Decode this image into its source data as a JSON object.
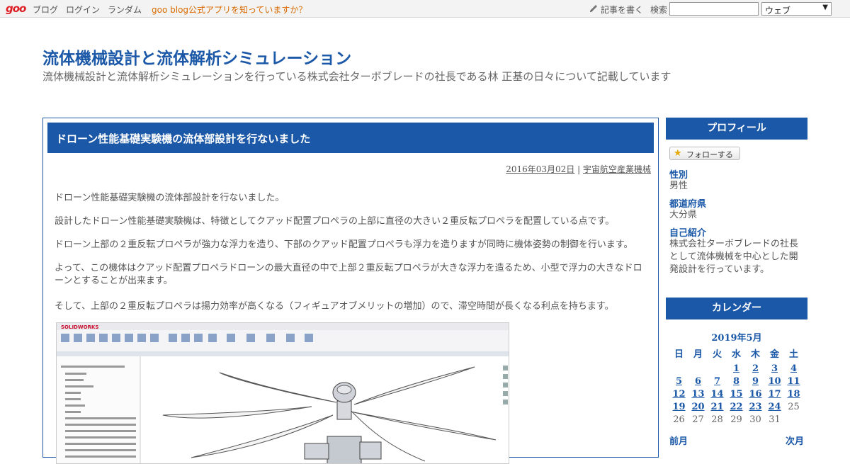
{
  "topbar": {
    "logo": "goo",
    "links": [
      "ブログ",
      "ログイン",
      "ランダム"
    ],
    "promo": "goo blog公式アプリを知っていますか？",
    "write": "記事を書く",
    "search_label": "検索",
    "search_value": "",
    "search_scope": "ウェブ"
  },
  "header": {
    "title": "流体機械設計と流体解析シミュレーション",
    "description": "流体機械設計と流体解析シミュレーションを行っている株式会社ターボブレードの社長である林 正基の日々について記載しています"
  },
  "article": {
    "title": "ドローン性能基礎実験機の流体部設計を行ないました",
    "date": "2016年03月02日",
    "separator": " | ",
    "category": "宇宙航空産業機械",
    "paragraphs": [
      "ドローン性能基礎実験機の流体部設計を行ないました。",
      "設計したドローン性能基礎実験機は、特徴としてクアッド配置プロペラの上部に直径の大きい２重反転プロペラを配置している点です。",
      "ドローン上部の２重反転プロペラが強力な浮力を造り、下部のクアッド配置プロペラも浮力を造りますが同時に機体姿勢の制御を行います。",
      "よって、この機体はクアッド配置プロペラドローンの最大直径の中で上部２重反転プロペラが大きな浮力を造るため、小型で浮力の大きなドローンとすることが出来ます。",
      "そして、上部の２重反転プロペラは揚力効率が高くなる（フィギュアオブメリットの増加）ので、滞空時間が長くなる利点を持ちます。"
    ],
    "image_caption": "SOLIDWORKS"
  },
  "sidebar": {
    "profile_heading": "プロフィール",
    "follow_label": "フォローする",
    "profile": [
      {
        "label": "性別",
        "value": "男性"
      },
      {
        "label": "都道府県",
        "value": "大分県"
      },
      {
        "label": "自己紹介",
        "value": "株式会社ターボブレードの社長として流体機械を中心とした開発設計を行っています。"
      }
    ],
    "calendar_heading": "カレンダー",
    "calendar": {
      "month": "2019年5月",
      "dow": [
        "日",
        "月",
        "火",
        "水",
        "木",
        "金",
        "土"
      ],
      "rows": [
        [
          "",
          "",
          "",
          "1",
          "2",
          "3",
          "4"
        ],
        [
          "5",
          "6",
          "7",
          "8",
          "9",
          "10",
          "11"
        ],
        [
          "12",
          "13",
          "14",
          "15",
          "16",
          "17",
          "18"
        ],
        [
          "19",
          "20",
          "21",
          "22",
          "23",
          "24",
          "25"
        ],
        [
          "26",
          "27",
          "28",
          "29",
          "30",
          "31",
          ""
        ]
      ],
      "linked_days": [
        "1",
        "2",
        "3",
        "4",
        "5",
        "6",
        "7",
        "8",
        "9",
        "10",
        "11",
        "12",
        "13",
        "14",
        "15",
        "16",
        "17",
        "18",
        "19",
        "20",
        "21",
        "22",
        "23",
        "24"
      ],
      "prev": "前月",
      "next": "次月"
    }
  },
  "colors": {
    "accent": "#1b58a7",
    "promo": "#d96b00",
    "logo": "#dd1f26"
  }
}
